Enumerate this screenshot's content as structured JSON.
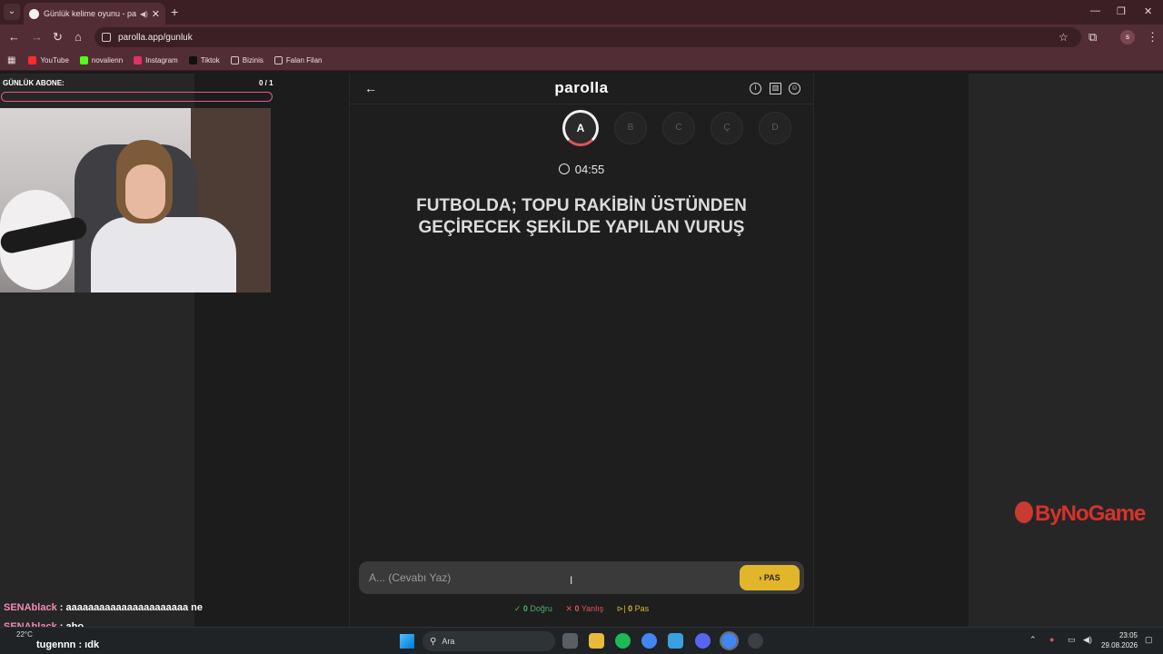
{
  "browser": {
    "tab_title": "Günlük kelime oyunu - paro",
    "url": "parolla.app/gunluk",
    "profile_initial": "s",
    "bookmarks": [
      "YouTube",
      "novalienn",
      "Instagram",
      "Tiktok",
      "Bizinis",
      "Falan Filan"
    ]
  },
  "overlay": {
    "abone_label": "GÜNLÜK ABONE:",
    "abone_count": "0 / 1",
    "abone_progress": 0,
    "chat": [
      {
        "user": "SENAblack",
        "message": " : aaaaaaaaaaaaaaaaaaaaaa ne"
      },
      {
        "user": "SENAblack",
        "message": " : abo"
      },
      {
        "user": "tugennn",
        "message": " : ıdk"
      }
    ],
    "sponsor": "ByNoGame"
  },
  "game": {
    "logo": "parolla",
    "letters": [
      "A",
      "B",
      "C",
      "Ç",
      "D"
    ],
    "active_letter": "A",
    "timer": "04:55",
    "question_line1": "FUTBOLDA; TOPU RAKİBİN ÜSTÜNDEN",
    "question_line2": "GEÇİRECEK ŞEKİLDE YAPILAN VURUŞ",
    "answer_placeholder": "A... (Cevabı Yaz)",
    "pas_label": "PAS",
    "stats": {
      "dogru_count": "0",
      "dogru_label": "Doğru",
      "yanlis_count": "0",
      "yanlis_label": "Yanlış",
      "pas_count": "0",
      "pas_label": "Pas"
    },
    "colors": {
      "pas_button": "#e2b62b",
      "active_ring": "#e0535e",
      "correct": "#4caf6a",
      "wrong": "#e05454"
    }
  },
  "taskbar": {
    "search_label": "Ara",
    "weather": "22°C",
    "time": "23:05",
    "date": "29.08.2026"
  }
}
